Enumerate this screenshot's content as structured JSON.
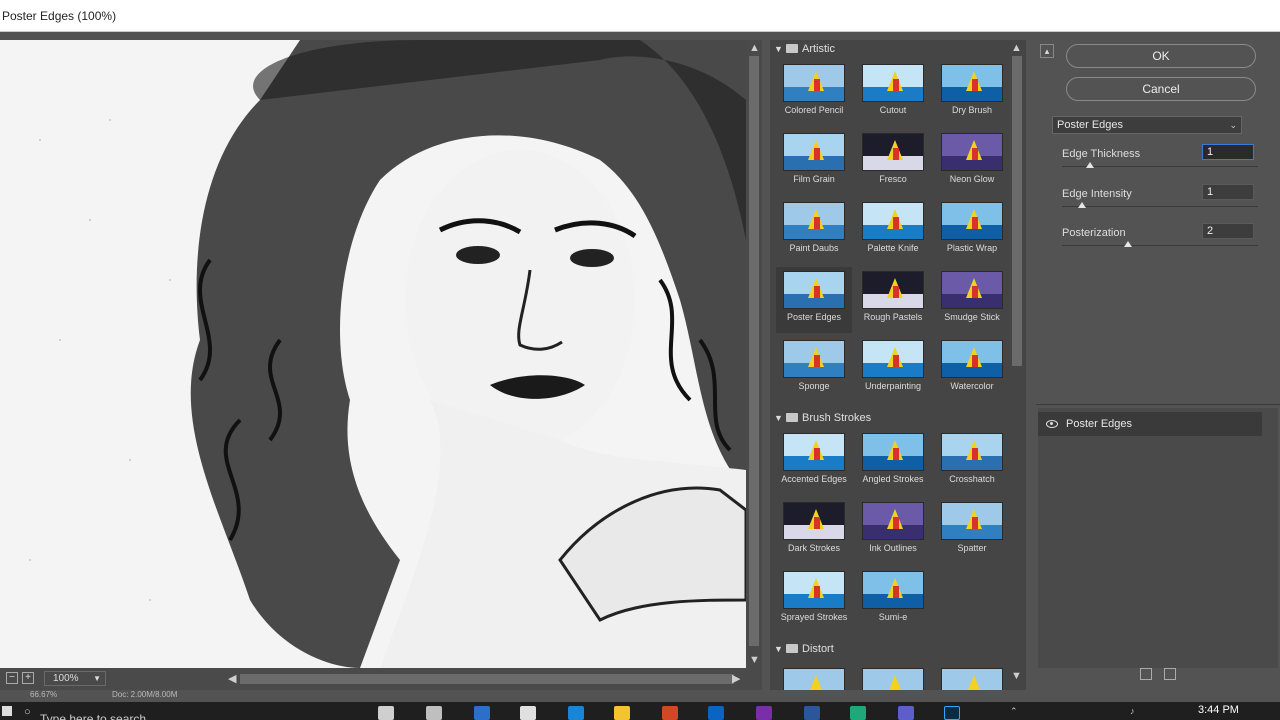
{
  "window": {
    "title": "Poster Edges (100%)"
  },
  "preview": {
    "zoom": "100%",
    "zoom_in_icon": "plus-square-icon",
    "zoom_out_icon": "minus-square-icon"
  },
  "gallery": {
    "categories": [
      {
        "name": "Artistic",
        "expanded": true,
        "filters": [
          "Colored Pencil",
          "Cutout",
          "Dry Brush",
          "Film Grain",
          "Fresco",
          "Neon Glow",
          "Paint Daubs",
          "Palette Knife",
          "Plastic Wrap",
          "Poster Edges",
          "Rough Pastels",
          "Smudge Stick",
          "Sponge",
          "Underpainting",
          "Watercolor"
        ]
      },
      {
        "name": "Brush Strokes",
        "expanded": true,
        "filters": [
          "Accented Edges",
          "Angled Strokes",
          "Crosshatch",
          "Dark Strokes",
          "Ink Outlines",
          "Spatter",
          "Sprayed Strokes",
          "Sumi-e"
        ]
      },
      {
        "name": "Distort",
        "expanded": true,
        "filters": []
      }
    ],
    "selected": "Poster Edges"
  },
  "controls": {
    "ok_label": "OK",
    "cancel_label": "Cancel",
    "filter_select": "Poster Edges",
    "params": [
      {
        "label": "Edge Thickness",
        "value": "1",
        "level": 0.1
      },
      {
        "label": "Edge Intensity",
        "value": "1",
        "level": 0.1
      },
      {
        "label": "Posterization",
        "value": "2",
        "level": 0.33
      }
    ]
  },
  "layers": {
    "items": [
      "Poster Edges"
    ]
  },
  "status": {
    "zoom": "66.67%",
    "doc": "Doc: 2.00M/8.00M"
  },
  "taskbar": {
    "search_placeholder": "Type here to search",
    "clock": "3:44 PM"
  }
}
